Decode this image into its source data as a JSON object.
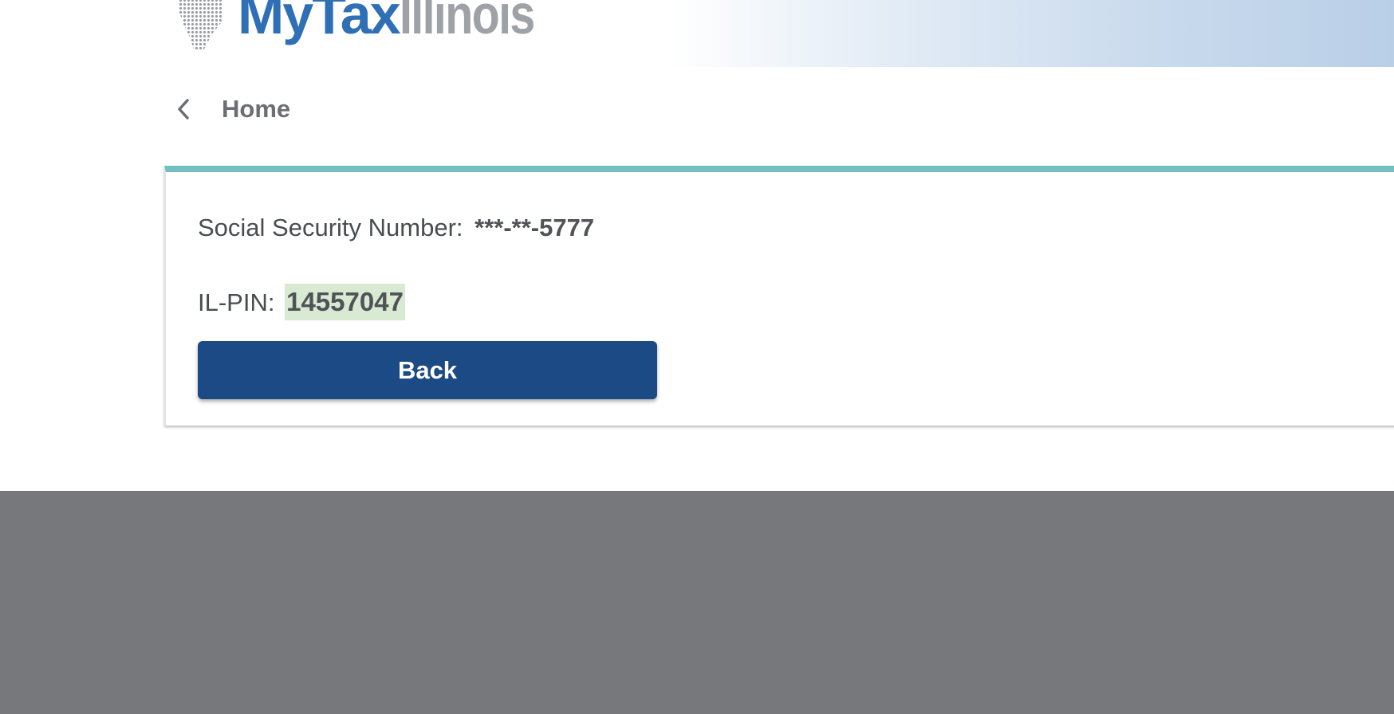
{
  "header": {
    "logo": {
      "brand_part1": "MyTax",
      "brand_part2": "Illinois"
    }
  },
  "breadcrumb": {
    "icon": "chevron-left-icon",
    "label": "Home"
  },
  "card": {
    "ssn_label": "Social Security Number:",
    "ssn_value": "***-**-5777",
    "pin_label": "IL-PIN:",
    "pin_value": "14557047",
    "back_label": "Back"
  },
  "colors": {
    "accent_bar": "#74bfc2",
    "primary_button": "#1c4a85",
    "pin_highlight": "#d9ead3",
    "footer": "#77787c",
    "brand_blue": "#2f6fb6"
  }
}
